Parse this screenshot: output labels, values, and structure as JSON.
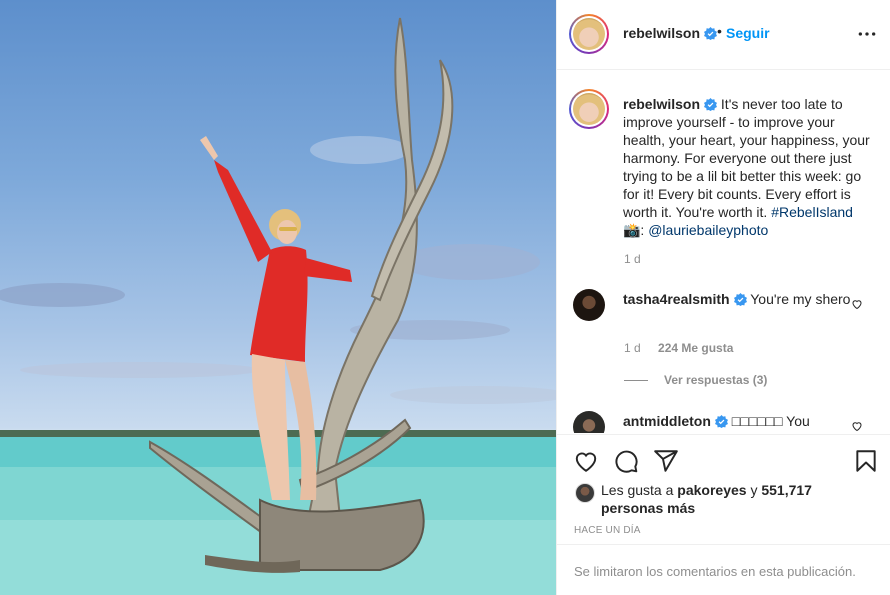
{
  "post": {
    "username": "rebelwilson",
    "follow_label": "Seguir",
    "dot_separator": "•",
    "caption_user": "rebelwilson",
    "caption_text": "It's never too late to improve yourself - to improve your health, your heart, your happiness, your harmony. For everyone out there just trying to be a lil bit better this week: go for it! Every bit counts. Every effort is worth it. You're worth it.",
    "hashtag": "#RebelIsland",
    "credit_prefix": "📸:",
    "credit_handle": "@lauriebaileyphoto",
    "age": "1 d",
    "colors": {
      "accent": "#0095f6",
      "text": "#262626",
      "muted": "#8e8e8e",
      "link": "#00376b"
    }
  },
  "comments": [
    {
      "username": "tasha4realsmith",
      "text": "You're my shero",
      "age": "1 d",
      "likes": "224 Me gusta",
      "replies": "Ver respuestas (3)"
    },
    {
      "username": "antmiddleton",
      "text": "□□□□□□ You"
    }
  ],
  "actions": {
    "icons": [
      "heart-icon",
      "comment-icon",
      "share-icon",
      "bookmark-icon"
    ]
  },
  "likes": {
    "prefix": "Les gusta a",
    "liker": "pakoreyes",
    "conjunction": "y",
    "others": "551,717 personas más"
  },
  "timestamp": "HACE UN DÍA",
  "comments_limited": "Se limitaron los comentarios en esta publicación."
}
